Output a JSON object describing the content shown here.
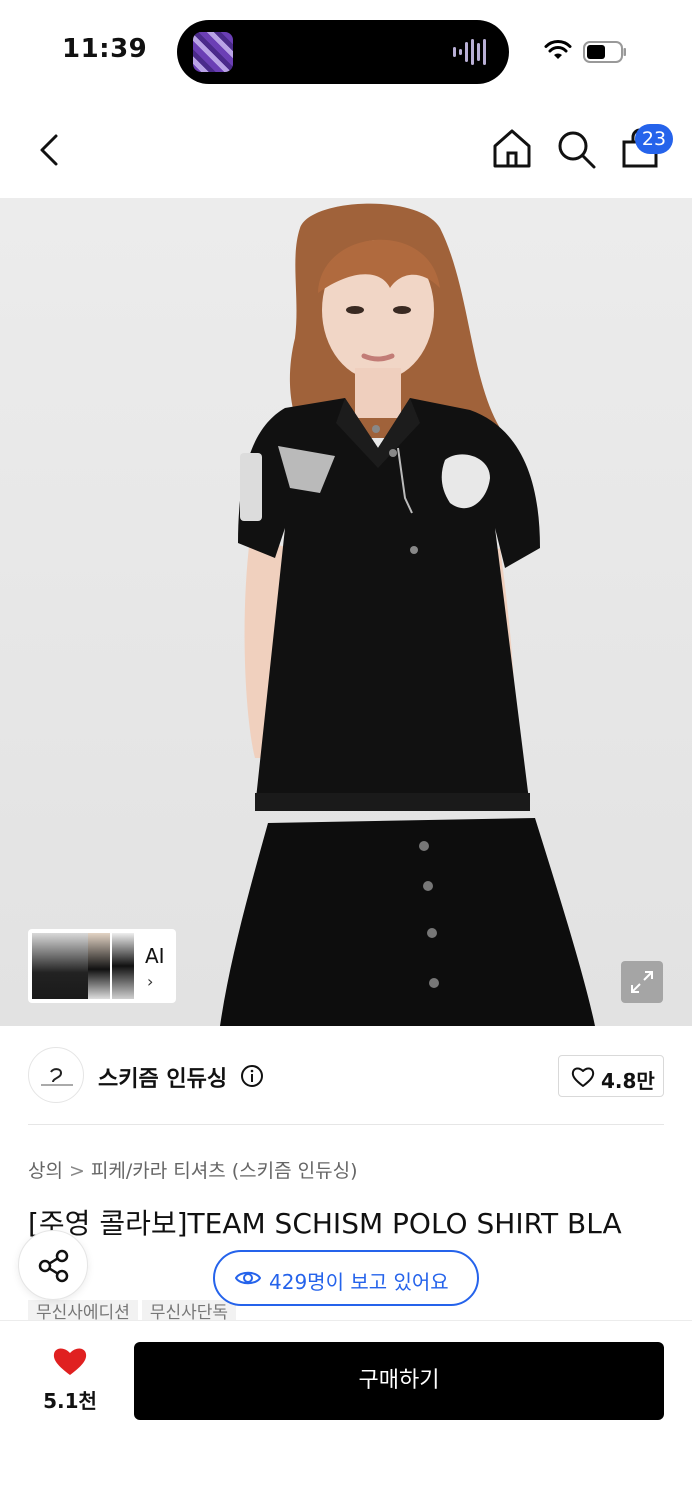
{
  "status_bar": {
    "time": "11:39"
  },
  "nav": {
    "cart_count": "23"
  },
  "gallery": {
    "ai_label": "AI",
    "ai_chevron": "›"
  },
  "brand": {
    "name": "스키즘 인듀싱",
    "likes": "4.8만"
  },
  "breadcrumb": {
    "category": "상의",
    "separator": ">",
    "subcategory": "피케/카라 티셔츠 (스키즘 인듀싱)"
  },
  "product": {
    "title": "[주영 콜라보]TEAM SCHISM POLO SHIRT BLA"
  },
  "viewers": {
    "text": "429명이 보고 있어요"
  },
  "tags": [
    "무신사에디션",
    "무신사단독"
  ],
  "bottom": {
    "wish_count": "5.1천",
    "buy_label": "구매하기"
  },
  "colors": {
    "accent_blue": "#2563eb",
    "heart_red": "#e02020",
    "buy_black": "#000000"
  },
  "icons": [
    "back-icon",
    "home-icon",
    "search-icon",
    "shopping-bag-icon",
    "expand-icon",
    "info-icon",
    "heart-outline-icon",
    "share-icon",
    "eye-icon",
    "heart-filled-icon",
    "wifi-icon",
    "battery-icon"
  ]
}
